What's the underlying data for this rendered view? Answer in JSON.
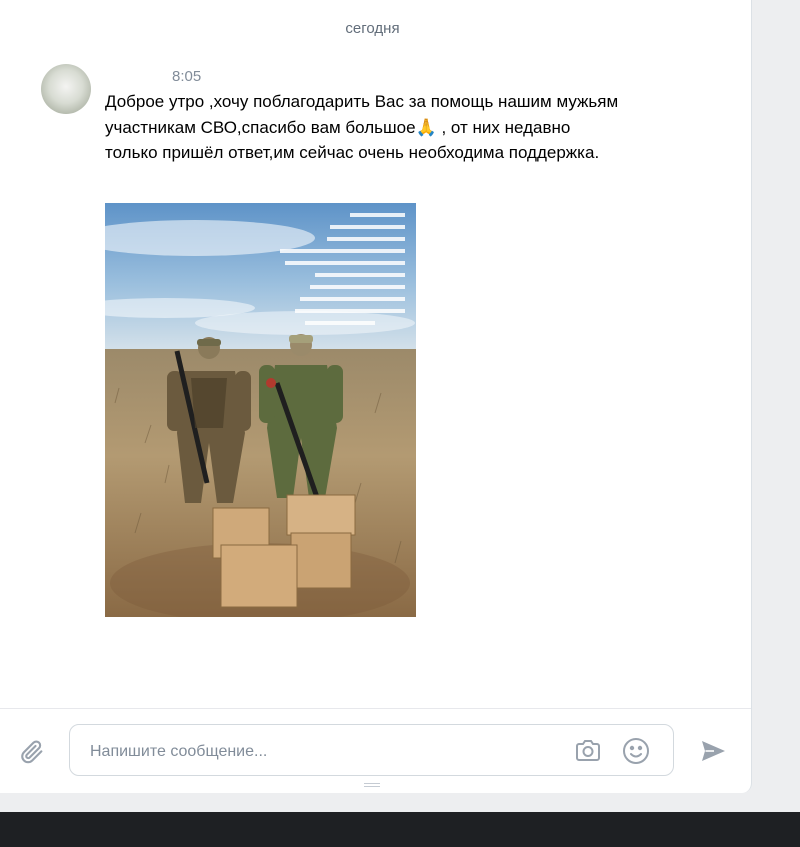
{
  "chat": {
    "date_separator": "сегодня",
    "message": {
      "time": "8:05",
      "text": "Доброе утро ,хочу поблагодарить Вас за помощь нашим мужьям участникам СВО,спасибо вам большое🙏 , от них недавно только пришёл ответ,им сейчас очень необходима поддержка."
    }
  },
  "composer": {
    "placeholder": "Напишите сообщение..."
  },
  "icons": {
    "attach": "paperclip-icon",
    "camera": "camera-icon",
    "emoji": "smile-icon",
    "send": "send-arrow-icon"
  },
  "colors": {
    "text_secondary": "#818c99",
    "icon": "#99a2ad",
    "border": "#d3d9de",
    "page_bg": "#edeef0"
  }
}
